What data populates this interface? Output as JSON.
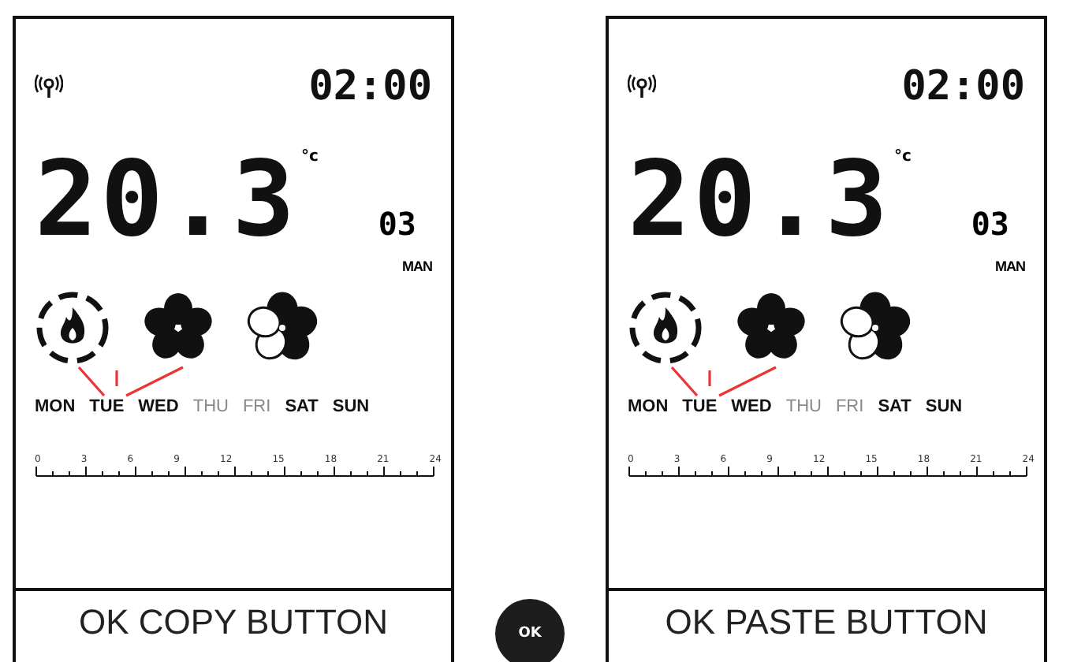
{
  "panels": [
    {
      "time": "02:00",
      "temperature": "20.3",
      "unit": "°c",
      "program": "03",
      "mode": "MAN",
      "days": [
        {
          "label": "MON",
          "active": true
        },
        {
          "label": "TUE",
          "active": true
        },
        {
          "label": "WED",
          "active": true
        },
        {
          "label": "THU",
          "active": false
        },
        {
          "label": "FRI",
          "active": false
        },
        {
          "label": "SAT",
          "active": true
        },
        {
          "label": "SUN",
          "active": true
        }
      ],
      "scale": [
        "0",
        "3",
        "6",
        "9",
        "12",
        "15",
        "18",
        "21",
        "24"
      ],
      "caption": "OK COPY BUTTON"
    },
    {
      "time": "02:00",
      "temperature": "20.3",
      "unit": "°c",
      "program": "03",
      "mode": "MAN",
      "days": [
        {
          "label": "MON",
          "active": true
        },
        {
          "label": "TUE",
          "active": true
        },
        {
          "label": "WED",
          "active": true
        },
        {
          "label": "THU",
          "active": false
        },
        {
          "label": "FRI",
          "active": false
        },
        {
          "label": "SAT",
          "active": true
        },
        {
          "label": "SUN",
          "active": true
        }
      ],
      "scale": [
        "0",
        "3",
        "6",
        "9",
        "12",
        "15",
        "18",
        "21",
        "24"
      ],
      "caption": "OK PASTE BUTTON"
    }
  ],
  "ok_button": {
    "label": "OK"
  }
}
